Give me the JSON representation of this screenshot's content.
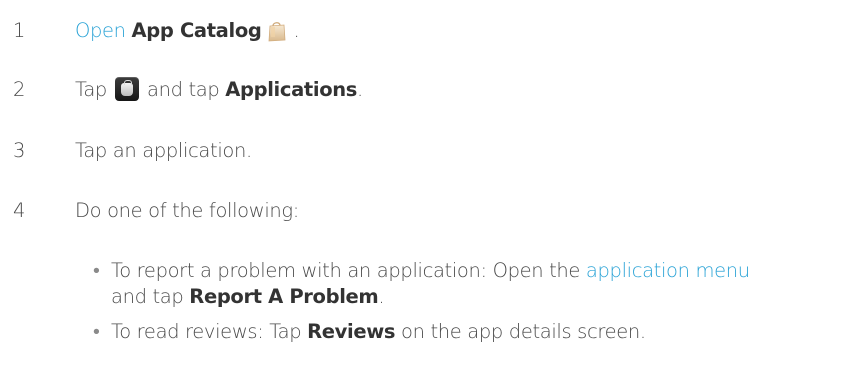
{
  "steps": [
    {
      "number": "1",
      "link": "Open",
      "bold": "App Catalog",
      "period": "."
    },
    {
      "number": "2",
      "prefix": "Tap",
      "middle": "and tap",
      "bold": "Applications",
      "period": "."
    },
    {
      "number": "3",
      "text": "Tap an application."
    },
    {
      "number": "4",
      "text": "Do one of the following:"
    }
  ],
  "bullets": [
    {
      "dot": "•",
      "prefix": "To report a problem with an application: Open the",
      "link": "application menu",
      "line2_prefix": "and tap",
      "bold": "Report A Problem",
      "period": "."
    },
    {
      "dot": "•",
      "prefix": "To read reviews: Tap",
      "bold": "Reviews",
      "suffix": "on the app details screen."
    }
  ],
  "icons": {
    "step1": "app-catalog-icon",
    "step2": "menu-tile-icon"
  },
  "colors": {
    "link": "#2aa3d6",
    "text": "#4a4a4a",
    "bold": "#333333"
  }
}
